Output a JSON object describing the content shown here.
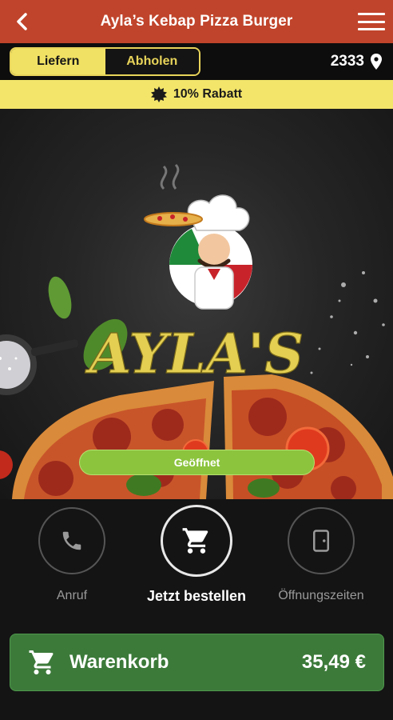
{
  "header": {
    "title": "Ayla’s Kebap Pizza Burger",
    "back_icon": "chevron-left-icon",
    "menu_icon": "hamburger-menu-icon",
    "color": "#c0442b"
  },
  "mode_toggle": {
    "options": [
      {
        "label": "Liefern",
        "active": true
      },
      {
        "label": "Abholen",
        "active": false
      }
    ],
    "accent": "#f0e164"
  },
  "location": {
    "postcode": "2333",
    "icon": "map-pin-icon"
  },
  "discount_banner": {
    "text": "10% Rabatt",
    "icon": "badge-icon",
    "color": "#f3e56a"
  },
  "hero": {
    "logo_text": "AYLA'S",
    "status": "Geöffnet",
    "status_color": "#8cc43e"
  },
  "actions": [
    {
      "label": "Anruf",
      "icon": "phone-icon"
    },
    {
      "label": "Jetzt bestellen",
      "icon": "shopping-cart-icon"
    },
    {
      "label": "Öffnungszeiten",
      "icon": "door-icon"
    }
  ],
  "cart": {
    "label": "Warenkorb",
    "total": "35,49 €",
    "icon": "shopping-cart-icon",
    "color": "#3c7a3a"
  }
}
